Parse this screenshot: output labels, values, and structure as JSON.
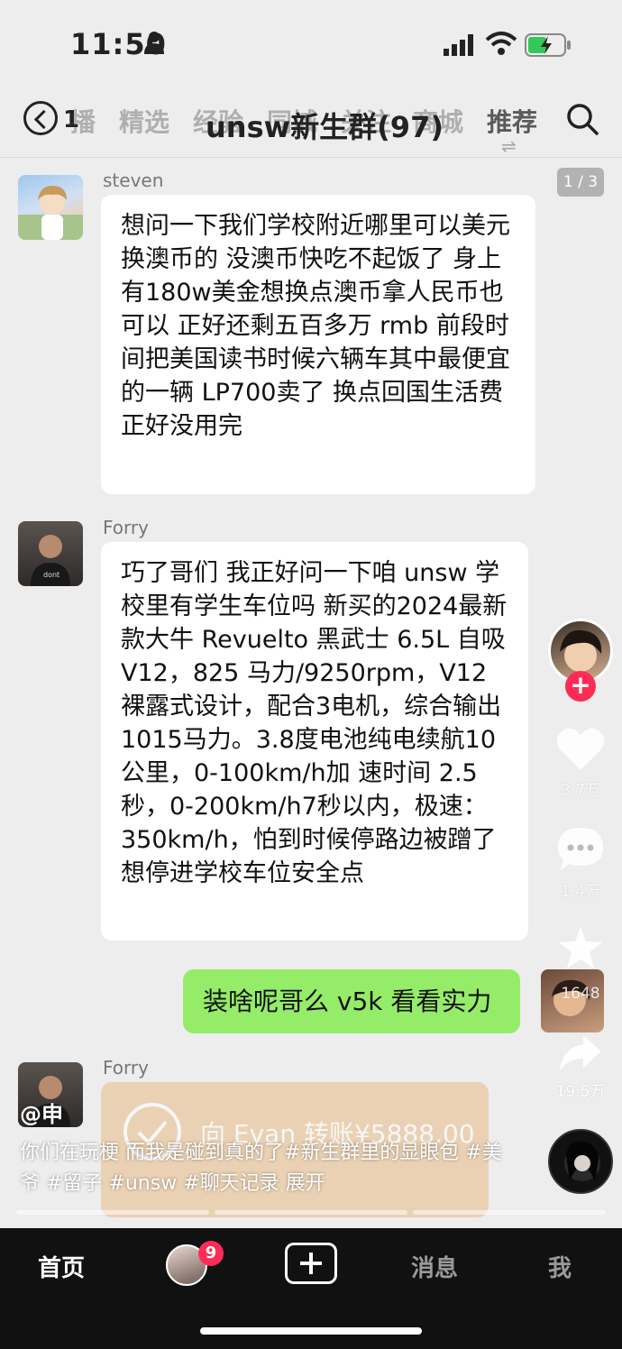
{
  "status_bar": {
    "time": "11:50"
  },
  "header": {
    "unread_count": "1",
    "tabs": [
      "播",
      "精选",
      "经验",
      "同城",
      "关注",
      "商城",
      "推荐"
    ],
    "chat_title": "unsw新生群(97)"
  },
  "page_indicator": "1 / 3",
  "messages": [
    {
      "sender": "steven",
      "text": "想问一下我们学校附近哪里可以美元换澳币的 没澳币快吃不起饭了 身上有180w美金想换点澳币拿人民币也可以 正好还剩五百多万 rmb 前段时间把美国读书时候六辆车其中最便宜的一辆 LP700卖了 换点回国生活费 正好没用完"
    },
    {
      "sender": "Forry",
      "text": "巧了哥们 我正好问一下咱 unsw 学校里有学生车位吗 新买的2024最新款大牛 Revuelto 黑武士 6.5L 自吸 V12，825 马力/9250rpm，V12 裸露式设计，配合3电机，综合输出1015马力。3.8度电池纯电续航10公里，0-100km/h加 速时间 2.5秒，0-200km/h7秒以内，极速：350km/h，怕到时候停路边被蹭了 想停进学校车位安全点"
    },
    {
      "sender": "me",
      "text": "装啥呢哥么 v5k 看看实力"
    },
    {
      "sender": "Forry",
      "text": "向 Evan 转账¥5888.00"
    }
  ],
  "side_actions": {
    "like_count": "3.7万",
    "comment_count": "1.4万",
    "favorite_count": "1648",
    "share_count": "19.5万"
  },
  "video_info": {
    "author": "@申",
    "caption": "你们在玩梗 而我是碰到真的了#新生群里的显眼包 #美爷 #留子 #unsw #聊天记录 展开"
  },
  "bottom_nav": {
    "home": "首页",
    "friends_badge": "9",
    "messages": "消息",
    "me": "我"
  },
  "colors": {
    "green_bubble": "#95ec69",
    "red_badge": "#fe2c55",
    "background": "#ededed"
  }
}
